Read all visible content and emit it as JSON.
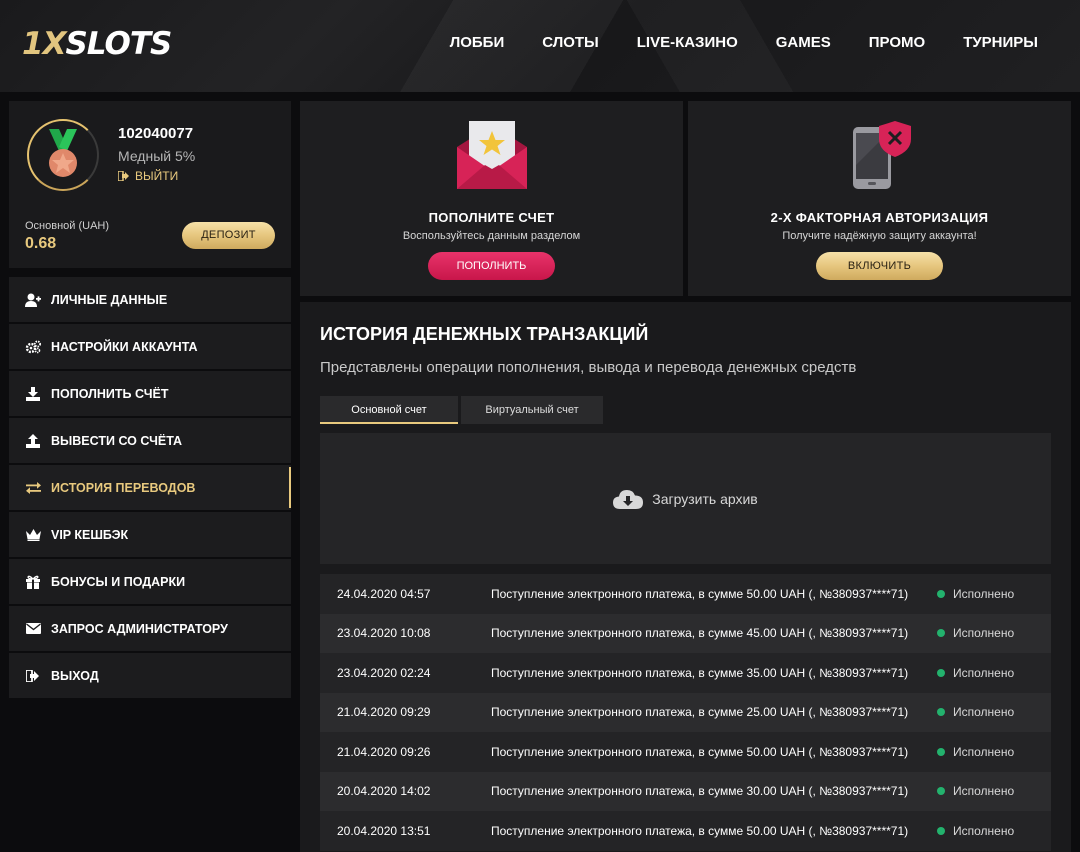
{
  "brand": {
    "part1": "1X",
    "part2": "SLOTS"
  },
  "nav": [
    {
      "label": "ЛОББИ"
    },
    {
      "label": "СЛОТЫ"
    },
    {
      "label": "LIVE-КАЗИНО"
    },
    {
      "label": "GAMES"
    },
    {
      "label": "ПРОМО"
    },
    {
      "label": "ТУРНИРЫ"
    }
  ],
  "profile": {
    "user_id": "102040077",
    "level": "Медный 5%",
    "logout_label": "ВЫЙТИ",
    "balance_label": "Основной (UAH)",
    "balance_value": "0.68",
    "deposit_label": "ДЕПОЗИТ"
  },
  "menu": [
    {
      "label": "ЛИЧНЫЕ ДАННЫЕ",
      "icon": "user-plus-icon"
    },
    {
      "label": "НАСТРОЙКИ АККАУНТА",
      "icon": "gears-icon"
    },
    {
      "label": "ПОПОЛНИТЬ СЧЁТ",
      "icon": "download-icon"
    },
    {
      "label": "ВЫВЕСТИ СО СЧЁТА",
      "icon": "upload-icon"
    },
    {
      "label": "ИСТОРИЯ ПЕРЕВОДОВ",
      "icon": "transfer-arrows-icon",
      "active": true
    },
    {
      "label": "VIP КЕШБЭК",
      "icon": "crown-icon"
    },
    {
      "label": "БОНУСЫ И ПОДАРКИ",
      "icon": "gift-icon"
    },
    {
      "label": "ЗАПРОС АДМИНИСТРАТОРУ",
      "icon": "envelope-icon"
    },
    {
      "label": "ВЫХОД",
      "icon": "logout-icon"
    }
  ],
  "promo": {
    "deposit": {
      "title": "ПОПОЛНИТЕ СЧЕТ",
      "subtitle": "Воспользуйтесь данным разделом",
      "button": "ПОПОЛНИТЬ"
    },
    "twofa": {
      "title": "2-Х ФАКТОРНАЯ АВТОРИЗАЦИЯ",
      "subtitle": "Получите надёжную защиту аккаунта!",
      "button": "ВКЛЮЧИТЬ"
    }
  },
  "history": {
    "title": "ИСТОРИЯ ДЕНЕЖНЫХ ТРАНЗАКЦИЙ",
    "subtitle": "Представлены операции пополнения, вывода и перевода денежных средств",
    "tabs": [
      {
        "label": "Основной счет",
        "active": true
      },
      {
        "label": "Виртуальный счет"
      }
    ],
    "archive_label": "Загрузить архив",
    "transactions": [
      {
        "date": "24.04.2020 04:57",
        "description": "Поступление электронного платежа, в сумме 50.00 UAH (, №380937****71)",
        "status": "Исполнено"
      },
      {
        "date": "23.04.2020 10:08",
        "description": "Поступление электронного платежа, в сумме 45.00 UAH (, №380937****71)",
        "status": "Исполнено"
      },
      {
        "date": "23.04.2020 02:24",
        "description": "Поступление электронного платежа, в сумме 35.00 UAH (, №380937****71)",
        "status": "Исполнено"
      },
      {
        "date": "21.04.2020 09:29",
        "description": "Поступление электронного платежа, в сумме 25.00 UAH (, №380937****71)",
        "status": "Исполнено"
      },
      {
        "date": "21.04.2020 09:26",
        "description": "Поступление электронного платежа, в сумме 50.00 UAH (, №380937****71)",
        "status": "Исполнено"
      },
      {
        "date": "20.04.2020 14:02",
        "description": "Поступление электронного платежа, в сумме 30.00 UAH (, №380937****71)",
        "status": "Исполнено"
      },
      {
        "date": "20.04.2020 13:51",
        "description": "Поступление электронного платежа, в сумме 50.00 UAH (, №380937****71)",
        "status": "Исполнено"
      }
    ]
  },
  "colors": {
    "accent_gold": "#e8c97e",
    "accent_pink": "#d9245a",
    "status_green": "#23b26d",
    "background": "#0c0c0e"
  }
}
